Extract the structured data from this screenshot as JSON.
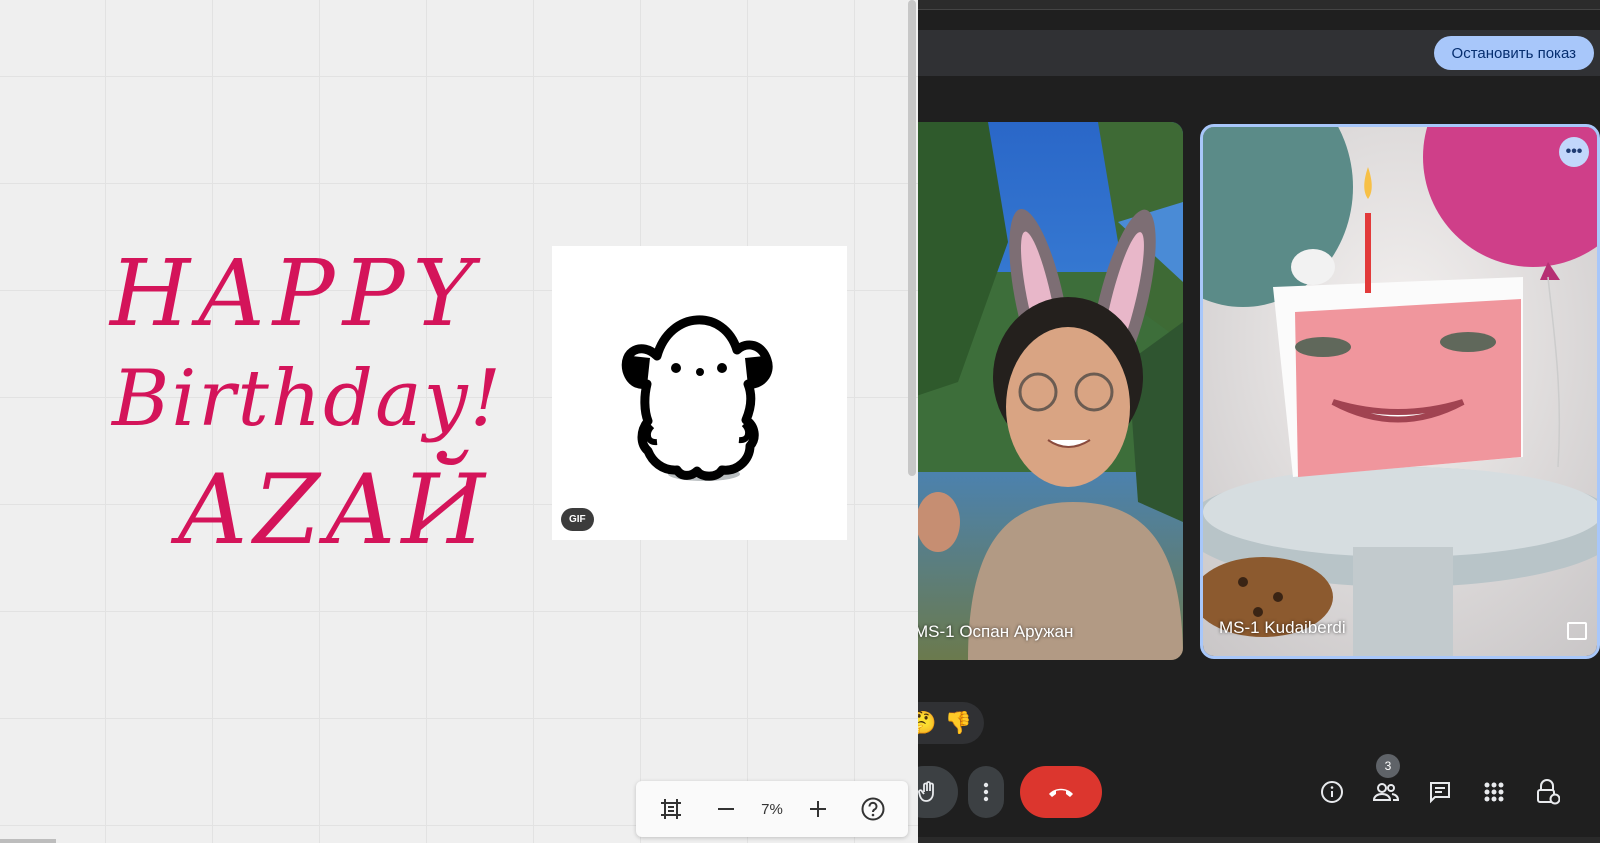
{
  "whiteboard": {
    "handwriting_lines": [
      "HAPPY",
      "Birthday!",
      "AZAЙ"
    ],
    "handwriting_color": "#d4145a",
    "gif_badge": "GIF",
    "zoom": {
      "value": "7%",
      "icons": [
        "frame-icon",
        "minus-icon",
        "plus-icon",
        "help-icon"
      ]
    }
  },
  "meet": {
    "stop_button_label": "Остановить показ",
    "participants": [
      {
        "name": "MS-1 Оспан Аружан"
      },
      {
        "name": "MS-1 Kudaiberdi"
      }
    ],
    "reactions": [
      "🤔",
      "👎"
    ],
    "people_count": "3",
    "accent_color": "#a8c7fa",
    "end_call_color": "#dc362e"
  }
}
